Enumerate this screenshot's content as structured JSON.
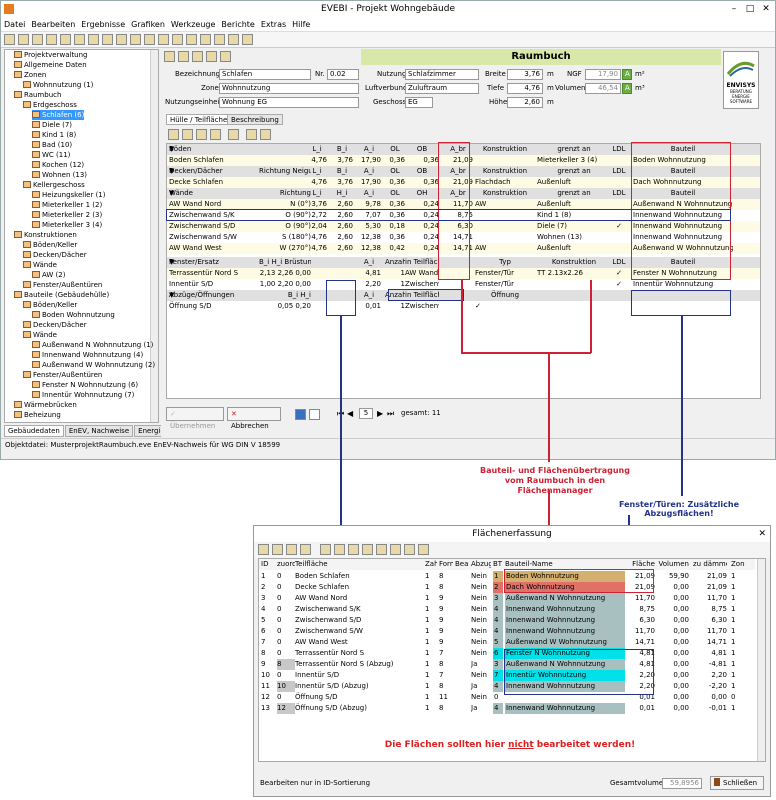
{
  "app": {
    "title": "EVEBI - Projekt Wohngebäude",
    "menu": [
      "Datei",
      "Bearbeiten",
      "Ergebnisse",
      "Grafiken",
      "Werkzeuge",
      "Berichte",
      "Extras",
      "Hilfe"
    ]
  },
  "tree": [
    {
      "label": "Projektverwaltung"
    },
    {
      "label": "Allgemeine Daten"
    },
    {
      "label": "Zonen"
    },
    {
      "label": "Wohnnutzung (1)"
    },
    {
      "label": "Raumbuch"
    },
    {
      "label": "Erdgeschoss"
    },
    {
      "label": "Schlafen (6)",
      "selected": true
    },
    {
      "label": "Diele (7)"
    },
    {
      "label": "Kind 1 (8)"
    },
    {
      "label": "Bad (10)"
    },
    {
      "label": "WC (11)"
    },
    {
      "label": "Kochen (12)"
    },
    {
      "label": "Wohnen (13)"
    },
    {
      "label": "Kellergeschoss"
    },
    {
      "label": "Heizungskeller (1)"
    },
    {
      "label": "Mieterkeller 1 (2)"
    },
    {
      "label": "Mieterkeller 2 (3)"
    },
    {
      "label": "Mieterkeller 3 (4)"
    },
    {
      "label": "Konstruktionen"
    },
    {
      "label": "Böden/Keller"
    },
    {
      "label": "Decken/Dächer"
    },
    {
      "label": "Wände"
    },
    {
      "label": "AW (2)"
    },
    {
      "label": "Fenster/Außentüren"
    },
    {
      "label": "Bauteile (Gebäudehülle)"
    },
    {
      "label": "Böden/Keller"
    },
    {
      "label": "Boden Wohnnutzung"
    },
    {
      "label": "Decken/Dächer"
    },
    {
      "label": "Wände"
    },
    {
      "label": "Außenwand N Wohnnutzung (1)"
    },
    {
      "label": "Innenwand Wohnnutzung (4)"
    },
    {
      "label": "Außenwand W Wohnnutzung (2)"
    },
    {
      "label": "Fenster/Außentüren"
    },
    {
      "label": "Fenster N Wohnnutzung (6)"
    },
    {
      "label": "Innentür Wohnnutzung (7)"
    },
    {
      "label": "Wärmebrücken"
    },
    {
      "label": "Beheizung"
    }
  ],
  "tabs_bottom": [
    "Gebäudedaten",
    "EnEV, Nachweise",
    "Energieberatung",
    "Varianten"
  ],
  "status": "Objektdatei: MusterprojektRaumbuch.eve  EnEV-Nachweis für WG DIN V 18599",
  "raumbuch": {
    "title": "Raumbuch",
    "logo": "ENVISYS",
    "logo_sub": "BERATUNG ENERGIE SOFTWARE",
    "fields": {
      "bezeichnung_label": "Bezeichnung",
      "bezeichnung": "Schlafen",
      "nr_label": "Nr.",
      "nr": "0.02",
      "nutzung_label": "Nutzung",
      "nutzung": "Schlafzimmer",
      "breite_label": "Breite",
      "breite": "3,76",
      "breite_unit": "m",
      "ngf_label": "NGF",
      "ngf": "17,90",
      "ngf_unit": "m²",
      "zone_label": "Zone",
      "zone": "Wohnnutzung",
      "luftverbund_label": "Luftverbund",
      "luftverbund": "Zuluftraum",
      "tiefe_label": "Tiefe",
      "tiefe": "4,76",
      "tiefe_unit": "m",
      "volumen_label": "Volumen",
      "volumen": "46,54",
      "volumen_unit": "m³",
      "nutzungseinheit_label": "Nutzungseinheit",
      "nutzungseinheit": "Wohnung EG",
      "geschoss_label": "Geschoss",
      "geschoss": "EG",
      "hoehe_label": "Höhe",
      "hoehe": "2,60",
      "hoehe_unit": "m",
      "a_badge": "A"
    },
    "tabs": [
      "Hülle / Teilflächen",
      "Beschreibung"
    ],
    "grid_rows": [
      {
        "kind": "hdr",
        "cells": [
          "▼",
          "Böden",
          "",
          "L_i",
          "B_i",
          "A_i",
          "OL",
          "OB",
          "A_br",
          "Konstruktion",
          "grenzt an",
          "LDL",
          "Bauteil"
        ]
      },
      {
        "kind": "data",
        "cells": [
          "",
          "Boden Schlafen",
          "",
          "4,76",
          "3,76",
          "17,90",
          "0,36",
          "0,36",
          "21,09",
          "",
          "Mieterkeller 3 (4)",
          "",
          "Boden Wohnnutzung"
        ]
      },
      {
        "kind": "hdr",
        "cells": [
          "▼",
          "Decken/Dächer",
          "Richtung  Neigung",
          "L_i",
          "B_i",
          "A_i",
          "OL",
          "OB",
          "A_br",
          "Konstruktion",
          "grenzt an",
          "LDL",
          "Bauteil"
        ]
      },
      {
        "kind": "data",
        "cells": [
          "",
          "Decke Schlafen",
          "",
          "4,76",
          "3,76",
          "17,90",
          "0,36",
          "0,36",
          "21,09",
          "Flachdach",
          "Außenluft",
          "",
          "Dach Wohnnutzung"
        ]
      },
      {
        "kind": "hdr",
        "cells": [
          "▼",
          "Wände",
          "Richtung",
          "L_i",
          "H_i",
          "A_i",
          "OL",
          "OH",
          "A_br",
          "Konstruktion",
          "grenzt an",
          "LDL",
          "Bauteil"
        ]
      },
      {
        "kind": "data",
        "cells": [
          "",
          "AW Wand Nord",
          "N (0°)",
          "3,76",
          "2,60",
          "9,78",
          "0,36",
          "0,24",
          "11,70",
          "AW",
          "Außenluft",
          "",
          "Außenwand N Wohnnutzung"
        ]
      },
      {
        "kind": "data",
        "cells": [
          "",
          "Zwischenwand S/K",
          "O (90°)",
          "2,72",
          "2,60",
          "7,07",
          "0,36",
          "0,24",
          "8,75",
          "",
          "Kind 1 (8)",
          "",
          "Innenwand Wohnnutzung"
        ]
      },
      {
        "kind": "data",
        "cells": [
          "",
          "Zwischenwand S/D",
          "O (90°)",
          "2,04",
          "2,60",
          "5,30",
          "0,18",
          "0,24",
          "6,30",
          "",
          "Diele (7)",
          "✓",
          "Innenwand Wohnnutzung"
        ]
      },
      {
        "kind": "data",
        "cells": [
          "",
          "Zwischenwand S/W",
          "S (180°)",
          "4,76",
          "2,60",
          "12,38",
          "0,36",
          "0,24",
          "14,71",
          "",
          "Wohnen (13)",
          "",
          "Innenwand Wohnnutzung"
        ]
      },
      {
        "kind": "data",
        "cells": [
          "",
          "AW Wand West",
          "W (270°)",
          "4,76",
          "2,60",
          "12,38",
          "0,42",
          "0,24",
          "14,71",
          "AW",
          "Außenluft",
          "",
          "Außenwand W Wohnnutzung"
        ]
      },
      {
        "kind": "hdr",
        "cells": [
          "▼",
          "Fenster/Ersatz",
          "B_i   H_i   Brüstung",
          "",
          "",
          "A_i",
          "Anzahl",
          "in Teilfläche",
          "",
          "Typ",
          "Konstruktion",
          "LDL",
          "Bauteil"
        ]
      },
      {
        "kind": "data",
        "cells": [
          "",
          "Terrassentür Nord S",
          "2,13   2,26   0,00",
          "",
          "",
          "4,81",
          "1",
          "AW Wand Nord",
          "",
          "Fenster/Tür",
          "TT 2.13x2.26",
          "✓",
          "Fenster N Wohnnutzung"
        ]
      },
      {
        "kind": "data",
        "cells": [
          "",
          "Innentür S/D",
          "1,00   2,20   0,00",
          "",
          "",
          "2,20",
          "1",
          "Zwischenwand S/D",
          "",
          "Fenster/Tür",
          "",
          "✓",
          "Innentür Wohnnutzung"
        ]
      },
      {
        "kind": "hdr",
        "cells": [
          "▼",
          "Abzüge/Öffnungen",
          "B_i   H_i",
          "",
          "",
          "A_i",
          "Anzahl",
          "in Teilfläche",
          "",
          "Öffnung",
          "",
          "",
          ""
        ]
      },
      {
        "kind": "data",
        "cells": [
          "",
          "Öffnung S/D",
          "0,05   0,20",
          "",
          "",
          "0,01",
          "1",
          "Zwischenwand S/D",
          "",
          "✓",
          "",
          "",
          ""
        ]
      }
    ],
    "buttons": {
      "uebernehmen": "Übernehmen",
      "abbrechen": "Abbrechen"
    },
    "pager": {
      "current": "5",
      "total_label": "gesamt: 11"
    }
  },
  "notes": {
    "transfer": "Bauteil- und Flächenübertragung vom Raumbuch in den Flächenmanager",
    "fenster": "Fenster/Türen: Zusätzliche Abzugsflächen!",
    "warning_pre": "Die Flächen sollten hier ",
    "warning_em": "nicht",
    "warning_post": " bearbeitet werden!"
  },
  "flaechen": {
    "title": "Flächenerfassung",
    "columns": [
      "ID",
      "zuord.",
      "Teilfläche",
      "Zahl",
      "Form",
      "Bearb",
      "Abzug",
      "BT",
      "Bauteil-Name",
      "Fläche",
      "Volumen",
      "zu dämmen",
      "Zone"
    ],
    "rows": [
      {
        "id": "1",
        "zuord": "0",
        "name": "Boden Schlafen",
        "zahl": "1",
        "form": "8",
        "abzug": "Nein",
        "bt": "1",
        "bauteil": "Boden Wohnnutzung",
        "flaeche": "21,09",
        "volumen": "59,90",
        "daemmen": "21,09",
        "zone": "1",
        "color": "#d4b070"
      },
      {
        "id": "2",
        "zuord": "0",
        "name": "Decke Schlafen",
        "zahl": "1",
        "form": "8",
        "abzug": "Nein",
        "bt": "2",
        "bauteil": "Dach Wohnnutzung",
        "flaeche": "21,09",
        "volumen": "0,00",
        "daemmen": "21,09",
        "zone": "1",
        "color": "#e07068"
      },
      {
        "id": "3",
        "zuord": "0",
        "name": "AW Wand Nord",
        "zahl": "1",
        "form": "9",
        "abzug": "Nein",
        "bt": "3",
        "bauteil": "Außenwand N Wohnnutzung",
        "flaeche": "11,70",
        "volumen": "0,00",
        "daemmen": "11,70",
        "zone": "1",
        "color": "#a8c0c0"
      },
      {
        "id": "4",
        "zuord": "0",
        "name": "Zwischenwand S/K",
        "zahl": "1",
        "form": "9",
        "abzug": "Nein",
        "bt": "4",
        "bauteil": "Innenwand Wohnnutzung",
        "flaeche": "8,75",
        "volumen": "0,00",
        "daemmen": "8,75",
        "zone": "1",
        "color": "#a8c0c0"
      },
      {
        "id": "5",
        "zuord": "0",
        "name": "Zwischenwand S/D",
        "zahl": "1",
        "form": "9",
        "abzug": "Nein",
        "bt": "4",
        "bauteil": "Innenwand Wohnnutzung",
        "flaeche": "6,30",
        "volumen": "0,00",
        "daemmen": "6,30",
        "zone": "1",
        "color": "#a8c0c0"
      },
      {
        "id": "6",
        "zuord": "0",
        "name": "Zwischenwand S/W",
        "zahl": "1",
        "form": "9",
        "abzug": "Nein",
        "bt": "4",
        "bauteil": "Innenwand Wohnnutzung",
        "flaeche": "11,70",
        "volumen": "0,00",
        "daemmen": "11,70",
        "zone": "1",
        "color": "#a8c0c0"
      },
      {
        "id": "7",
        "zuord": "0",
        "name": "AW Wand West",
        "zahl": "1",
        "form": "9",
        "abzug": "Nein",
        "bt": "5",
        "bauteil": "Außenwand W Wohnnutzung",
        "flaeche": "14,71",
        "volumen": "0,00",
        "daemmen": "14,71",
        "zone": "1",
        "color": "#a8c0c0"
      },
      {
        "id": "8",
        "zuord": "0",
        "name": "Terrassentür Nord S",
        "zahl": "1",
        "form": "7",
        "abzug": "Nein",
        "bt": "6",
        "bauteil": "Fenster N Wohnnutzung",
        "flaeche": "4,81",
        "volumen": "0,00",
        "daemmen": "4,81",
        "zone": "1",
        "color": "#00e0e8"
      },
      {
        "id": "9",
        "zuord": "8",
        "name": "Terrassentür Nord S (Abzug)",
        "zahl": "1",
        "form": "8",
        "abzug": "Ja",
        "bt": "3",
        "bauteil": "Außenwand N Wohnnutzung",
        "flaeche": "4,81",
        "volumen": "0,00",
        "daemmen": "-4,81",
        "zone": "1",
        "color": "#a8c0c0"
      },
      {
        "id": "10",
        "zuord": "0",
        "name": "Innentür S/D",
        "zahl": "1",
        "form": "7",
        "abzug": "Nein",
        "bt": "7",
        "bauteil": "Innentür Wohnnutzung",
        "flaeche": "2,20",
        "volumen": "0,00",
        "daemmen": "2,20",
        "zone": "1",
        "color": "#00e0e8"
      },
      {
        "id": "11",
        "zuord": "10",
        "name": "Innentür S/D (Abzug)",
        "zahl": "1",
        "form": "8",
        "abzug": "Ja",
        "bt": "4",
        "bauteil": "Innenwand Wohnnutzung",
        "flaeche": "2,20",
        "volumen": "0,00",
        "daemmen": "-2,20",
        "zone": "1",
        "color": "#a8c0c0"
      },
      {
        "id": "12",
        "zuord": "0",
        "name": "Öffnung S/D",
        "zahl": "1",
        "form": "11",
        "abzug": "Nein",
        "bt": "0",
        "bauteil": "",
        "flaeche": "0,01",
        "volumen": "0,00",
        "daemmen": "0,00",
        "zone": "0",
        "color": "#ffffff"
      },
      {
        "id": "13",
        "zuord": "12",
        "name": "Öffnung S/D (Abzug)",
        "zahl": "1",
        "form": "8",
        "abzug": "Ja",
        "bt": "4",
        "bauteil": "Innenwand Wohnnutzung",
        "flaeche": "0,01",
        "volumen": "0,00",
        "daemmen": "-0,01",
        "zone": "1",
        "color": "#a8c0c0"
      }
    ],
    "footer_left": "Bearbeiten nur in ID-Sortierung",
    "gesamtvolumen_label": "Gesamtvolumen",
    "gesamtvolumen": "59,8956",
    "close": "Schließen"
  },
  "colors": {
    "red": "#cc2233",
    "blue": "#223388",
    "header_green": "#d8e8a8"
  }
}
